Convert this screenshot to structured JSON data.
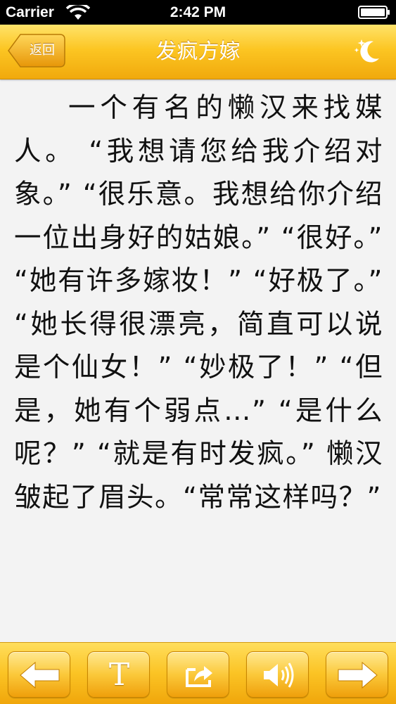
{
  "status_bar": {
    "carrier": "Carrier",
    "time": "2:42 PM"
  },
  "nav": {
    "back_label": "返回",
    "title": "发疯方嫁"
  },
  "article": {
    "text": "一个有名的懒汉来找媒人。 “我想请您给我介绍对象。” “很乐意。我想给你介绍一位出身好的姑娘。” “很好。” “她有许多嫁妆！” “好极了。” “她长得很漂亮，简直可以说是个仙女！” “妙极了！” “但是，她有个弱点…” “是什么呢？” “就是有时发疯。” 懒汉皱起了眉头。“常常这样吗？”"
  },
  "toolbar": {
    "text_button_label": "T",
    "buttons": [
      "arrow-left-icon",
      "text-size-icon",
      "share-icon",
      "speaker-icon",
      "arrow-right-icon"
    ]
  },
  "colors": {
    "bar_yellow": "#fcc623",
    "bar_orange": "#f1a90c",
    "page_bg": "#f3f3f3",
    "text": "#111111"
  }
}
